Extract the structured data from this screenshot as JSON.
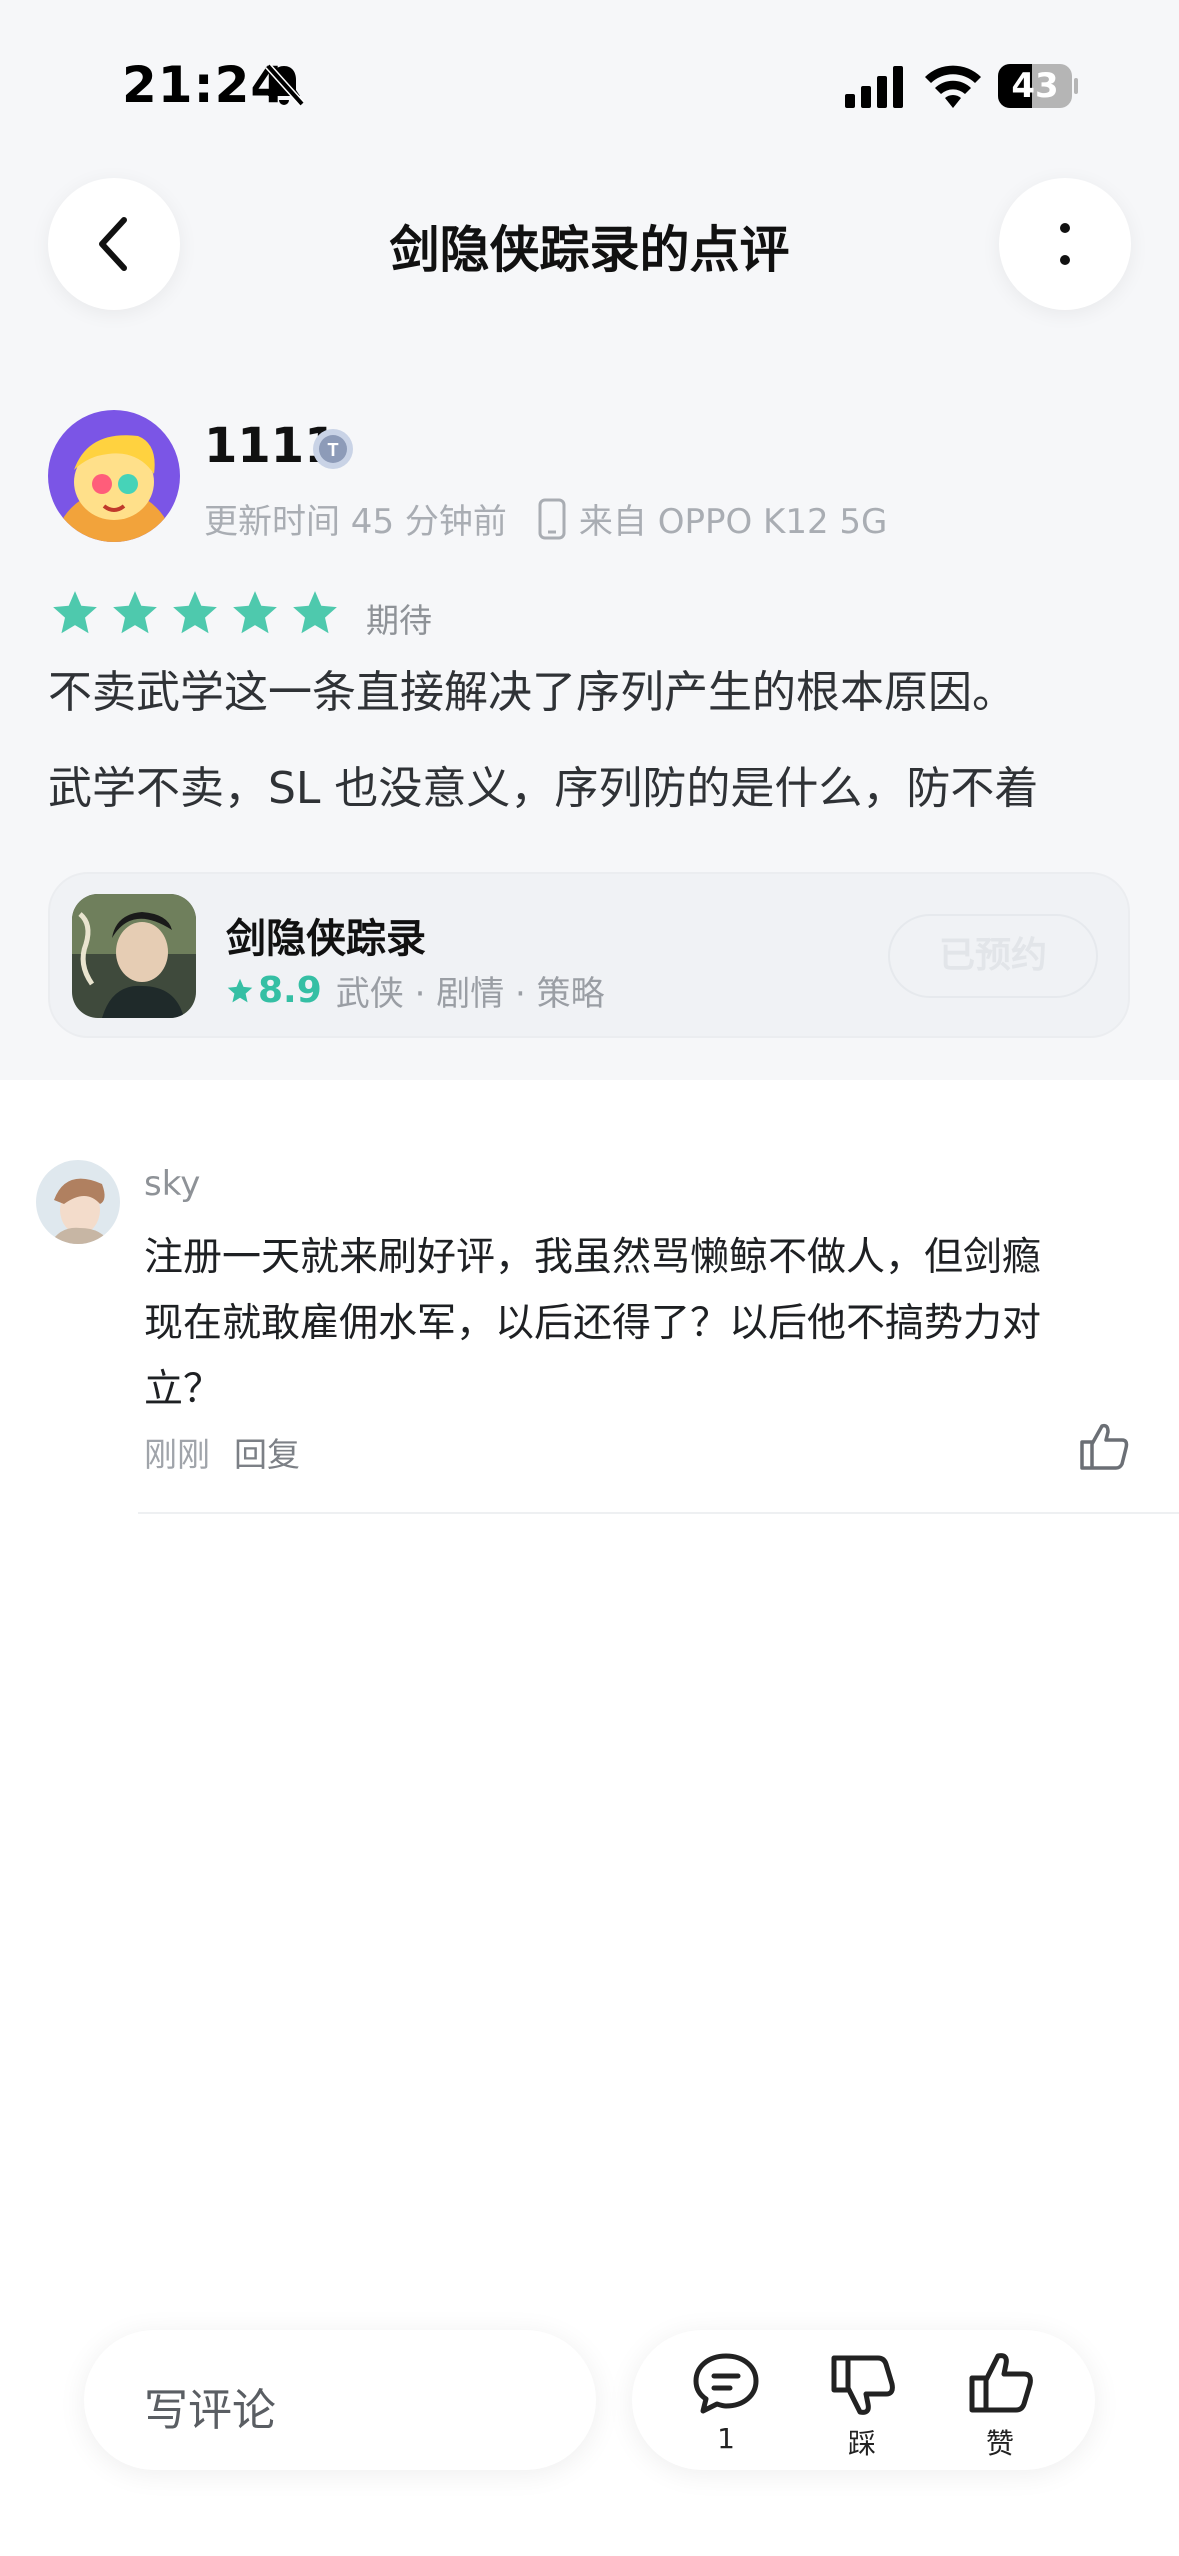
{
  "status_bar": {
    "time": "21:24",
    "battery": "43"
  },
  "header": {
    "title": "剑隐侠踪录的点评"
  },
  "review": {
    "username": "1111",
    "updated": "更新时间 45 分钟前",
    "device": "来自 OPPO K12 5G",
    "stars": 5,
    "rating_label": "期待",
    "lines": [
      "不卖武学这一条直接解决了序列产生的根本原因。",
      "武学不卖，SL 也没意义，序列防的是什么，防不着"
    ]
  },
  "game_card": {
    "name": "剑隐侠踪录",
    "score": "8.9",
    "tags": "武侠 · 剧情 · 策略",
    "button": "已预约"
  },
  "comments": [
    {
      "name": "sky",
      "lines": [
        "注册一天就来刷好评，我虽然骂懒鲸不做人，但剑瘾",
        "现在就敢雇佣水军，以后还得了？以后他不搞势力对",
        "立？"
      ],
      "time": "刚刚",
      "reply": "回复"
    }
  ],
  "bottom_bar": {
    "write_placeholder": "写评论",
    "comment_count": "1",
    "dislike_label": "踩",
    "like_label": "赞"
  },
  "colors": {
    "accent": "#35bfa4",
    "star": "#4ec9ad"
  }
}
